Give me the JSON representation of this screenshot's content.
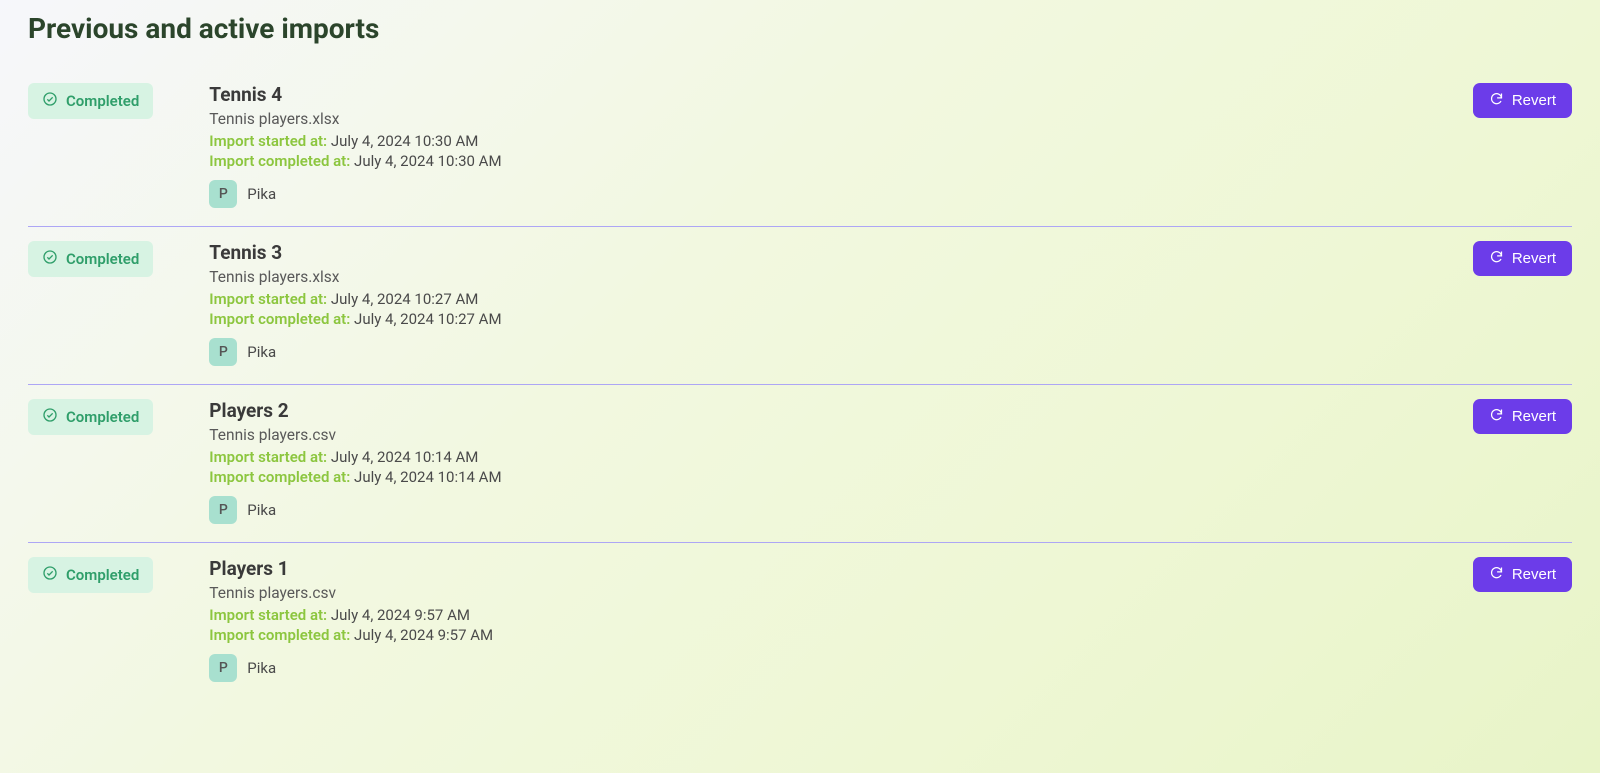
{
  "page": {
    "title": "Previous and active imports"
  },
  "colors": {
    "accent": "#6c3ce9",
    "status_success_bg": "#d7f3e3",
    "status_success_fg": "#2f9e6a",
    "meta_label": "#8cc63f"
  },
  "labels": {
    "started": "Import started at:",
    "completed": "Import completed at:",
    "revert": "Revert"
  },
  "imports": [
    {
      "status": "Completed",
      "title": "Tennis 4",
      "file": "Tennis players.xlsx",
      "started_at": "July 4, 2024 10:30 AM",
      "completed_at": "July 4, 2024 10:30 AM",
      "user": {
        "initial": "P",
        "name": "Pika"
      }
    },
    {
      "status": "Completed",
      "title": "Tennis 3",
      "file": "Tennis players.xlsx",
      "started_at": "July 4, 2024 10:27 AM",
      "completed_at": "July 4, 2024 10:27 AM",
      "user": {
        "initial": "P",
        "name": "Pika"
      }
    },
    {
      "status": "Completed",
      "title": "Players 2",
      "file": "Tennis players.csv",
      "started_at": "July 4, 2024 10:14 AM",
      "completed_at": "July 4, 2024 10:14 AM",
      "user": {
        "initial": "P",
        "name": "Pika"
      }
    },
    {
      "status": "Completed",
      "title": "Players 1",
      "file": "Tennis players.csv",
      "started_at": "July 4, 2024 9:57 AM",
      "completed_at": "July 4, 2024 9:57 AM",
      "user": {
        "initial": "P",
        "name": "Pika"
      }
    }
  ]
}
